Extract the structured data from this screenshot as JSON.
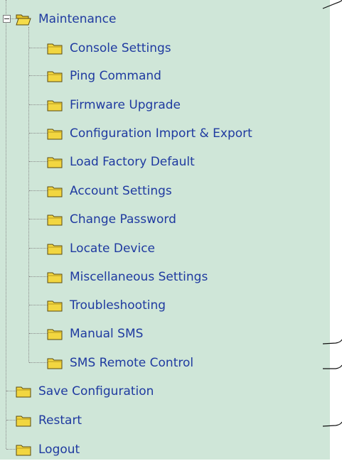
{
  "tree": {
    "parent": {
      "label": "Maintenance",
      "expanded": true
    },
    "children": [
      {
        "label": "Console Settings"
      },
      {
        "label": "Ping Command"
      },
      {
        "label": "Firmware Upgrade"
      },
      {
        "label": "Configuration Import & Export"
      },
      {
        "label": "Load Factory Default"
      },
      {
        "label": "Account Settings"
      },
      {
        "label": "Change Password"
      },
      {
        "label": "Locate Device"
      },
      {
        "label": "Miscellaneous Settings"
      },
      {
        "label": "Troubleshooting"
      },
      {
        "label": "Manual SMS"
      },
      {
        "label": "SMS Remote Control"
      }
    ],
    "root_items": [
      {
        "label": "Save Configuration"
      },
      {
        "label": "Restart"
      },
      {
        "label": "Logout"
      }
    ]
  },
  "colors": {
    "panel_background": "#cfe6d8",
    "link_text": "#1f3aa0",
    "folder_fill": "#f2d640",
    "folder_outline": "#5a4a10"
  },
  "icons": {
    "closed_folder": "folder-icon",
    "open_folder": "folder-open-icon",
    "collapse": "minus-box-icon"
  }
}
